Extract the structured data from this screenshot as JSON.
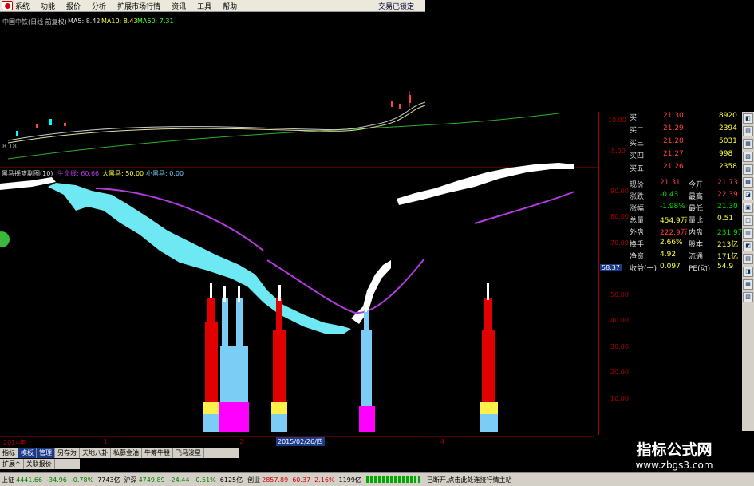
{
  "menu": {
    "items": [
      "系统",
      "功能",
      "报价",
      "分析",
      "扩展市场行情",
      "资讯",
      "工具",
      "帮助"
    ],
    "status": "交易已锁定"
  },
  "main_chart": {
    "title": "中国中铁(日线 前复权)",
    "ma5": "MA5: 8.42",
    "ma10": "MA10: 8.43",
    "ma60": "MA60: 7.31",
    "axis": [
      "10.00",
      "5.00"
    ],
    "left_label": "8.18"
  },
  "indicator": {
    "title": "黑马摇篮副图(10)",
    "lifeline": "生命线: 60.66",
    "big": "大黑马: 50.00",
    "small": "小黑马: 0.00",
    "axis": [
      "90.00",
      "80.00",
      "70.00",
      "60.00",
      "50.00",
      "40.00",
      "30.00",
      "20.00",
      "10.00"
    ],
    "current": "58.37",
    "colors": {
      "cyan": "#6ee8f2",
      "white": "#ffffff",
      "purple": "#b23be0",
      "red": "#e10000",
      "light_blue": "#7bcdf5",
      "yellow": "#fff04a",
      "magenta": "#ff00ff"
    }
  },
  "date_axis": {
    "year": "2014年",
    "m1": "1",
    "m2": "2",
    "selected": "2015/02/26/四",
    "m4": "4"
  },
  "quote": {
    "bids": [
      {
        "label": "买一",
        "price": "21.30",
        "vol": "8920"
      },
      {
        "label": "买二",
        "price": "21.29",
        "vol": "2394"
      },
      {
        "label": "买三",
        "price": "21.28",
        "vol": "5031"
      },
      {
        "label": "买四",
        "price": "21.27",
        "vol": "998"
      },
      {
        "label": "买五",
        "price": "21.26",
        "vol": "2358"
      }
    ],
    "stats": [
      {
        "l1": "现价",
        "v1": "21.31",
        "l2": "今开",
        "v2": "21.73",
        "c1": "#ff4040",
        "c2": "#ff4040"
      },
      {
        "l1": "涨跌",
        "v1": "-0.43",
        "l2": "最高",
        "v2": "22.39",
        "c1": "#00e000",
        "c2": "#ff4040"
      },
      {
        "l1": "涨幅",
        "v1": "-1.98%",
        "l2": "最低",
        "v2": "21.30",
        "c1": "#00e000",
        "c2": "#00e000"
      },
      {
        "l1": "总量",
        "v1": "454.9万",
        "l2": "量比",
        "v2": "0.51",
        "c1": "#ffff40",
        "c2": "#ffff40"
      },
      {
        "l1": "外盘",
        "v1": "222.9万",
        "l2": "内盘",
        "v2": "231.9万",
        "c1": "#ff4040",
        "c2": "#00e000"
      },
      {
        "l1": "换手",
        "v1": "2.66%",
        "l2": "股本",
        "v2": "213亿",
        "c1": "#ffff40",
        "c2": "#ffff40"
      },
      {
        "l1": "净资",
        "v1": "4.92",
        "l2": "流通",
        "v2": "171亿",
        "c1": "#ffff40",
        "c2": "#ffff40"
      },
      {
        "l1": "收益(一)",
        "v1": "0.097",
        "l2": "PE(动)",
        "v2": "54.9",
        "c1": "#ffff40",
        "c2": "#ffff40"
      }
    ]
  },
  "tabs1": [
    "指标",
    "模板",
    "管理",
    "另存为",
    "天地八卦",
    "私募金油",
    "牛筹牛股",
    "飞马浚星"
  ],
  "tabs2": [
    "扩展^",
    "关联报价"
  ],
  "bottom": {
    "sh_label": "上证",
    "sh_val": "4441.66",
    "sh_chg": "-34.96",
    "sh_pct": "-0.78%",
    "sh_amt": "7743亿",
    "hs_label": "沪深",
    "hs_val": "4749.89",
    "hs_chg": "-24.44",
    "hs_pct": "-0.51%",
    "hs_amt": "6125亿",
    "cy_label": "创业",
    "cy_val": "2857.89",
    "cy_chg": "60.37",
    "cy_pct": "2.16%",
    "cy_amt": "1199亿",
    "msg": "已断开,点击此处连接行情主站"
  },
  "watermark": {
    "title": "指标公式网",
    "url": "www.zbgs3.com"
  }
}
